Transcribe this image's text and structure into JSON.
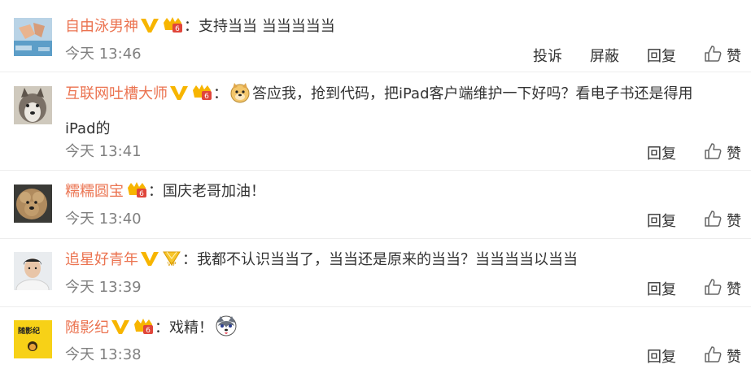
{
  "comments": [
    {
      "username": "自由泳男神",
      "badges": [
        "v-badge",
        "level-badge"
      ],
      "colon": "：",
      "text": "支持当当 当当当当当",
      "time": "今天 13:46",
      "actions": {
        "report": "投诉",
        "block": "屏蔽",
        "reply": "回复",
        "like": "赞"
      }
    },
    {
      "username": "互联网吐槽大师",
      "badges": [
        "v-badge",
        "level-badge"
      ],
      "colon": "：",
      "emoji": "doge-emoji",
      "text": "答应我，抢到代码，把iPad客户端维护一下好吗？看电子书还是得用",
      "text2": "iPad的",
      "time": "今天 13:41",
      "actions": {
        "reply": "回复",
        "like": "赞"
      }
    },
    {
      "username": "糯糯圆宝",
      "badges": [
        "level-badge"
      ],
      "colon": "：",
      "text": "国庆老哥加油！",
      "time": "今天 13:40",
      "actions": {
        "reply": "回复",
        "like": "赞"
      }
    },
    {
      "username": "追星好青年",
      "badges": [
        "v-badge",
        "vip-badge"
      ],
      "colon": "：",
      "text": "我都不认识当当了，当当还是原来的当当？当当当当以当当",
      "time": "今天 13:39",
      "actions": {
        "reply": "回复",
        "like": "赞"
      }
    },
    {
      "username": "随影纪",
      "badges": [
        "v-badge",
        "level-badge"
      ],
      "colon": "：",
      "text": "戏精！",
      "emoji_after": "husky-emoji",
      "avatar_text": "随影纪",
      "time": "今天 13:38",
      "actions": {
        "reply": "回复",
        "like": "赞"
      }
    }
  ],
  "colors": {
    "username": "#eb7350",
    "time": "#808080",
    "badge_v": "#f7b500",
    "badge_level": "#e0463b"
  }
}
